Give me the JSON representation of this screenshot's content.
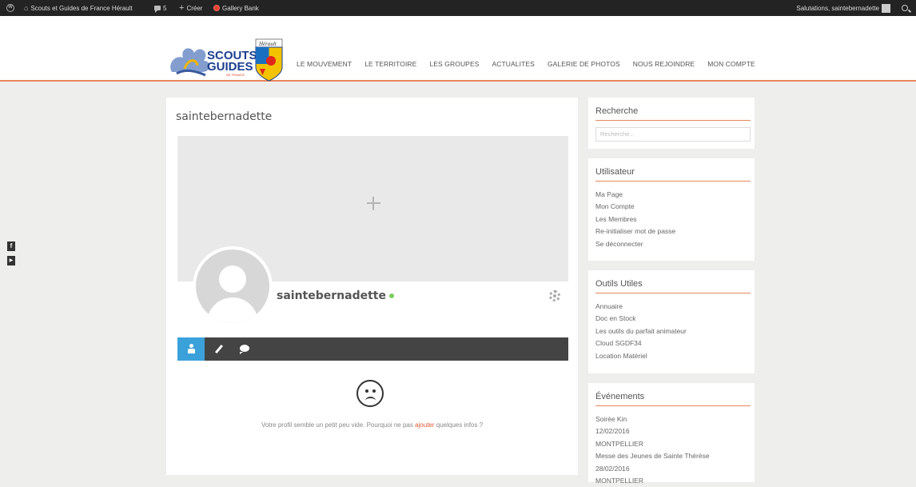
{
  "admin_bar": {
    "site_name": "Scouts et Guides de France Hérault",
    "comments_count": "5",
    "new_label": "Créer",
    "plugin_label": "Gallery Bank",
    "greeting": "Salutations, saintebernadette"
  },
  "header": {
    "logo_text_line1": "SCOUTS",
    "logo_text_line2": "GUIDES",
    "logo_text_line3": "DE FRANCE",
    "shield_text": "Hérault",
    "nav": [
      "LE MOUVEMENT",
      "LE TERRITOIRE",
      "LES GROUPES",
      "ACTUALITES",
      "GALERIE DE PHOTOS",
      "NOUS REJOINDRE",
      "MON COMPTE"
    ]
  },
  "social": {
    "facebook": "f",
    "youtube": "▶"
  },
  "profile": {
    "page_title": "saintebernadette",
    "name": "saintebernadette",
    "empty_message_before": "Votre profil semble un petit peu vide. Pourquoi ne pas ",
    "empty_message_link": "ajouter",
    "empty_message_after": " quelques infos ?"
  },
  "sidebar": {
    "search": {
      "title": "Recherche",
      "placeholder": "Recherche..."
    },
    "user": {
      "title": "Utilisateur",
      "items": [
        "Ma Page",
        "Mon Compte",
        "Les Membres",
        "Re-initialiser mot de passe",
        "Se déconnecter"
      ]
    },
    "tools": {
      "title": "Outils Utiles",
      "items": [
        "Annuaire",
        "Doc en Stock",
        "Les outils du parfait animateur",
        "Cloud SGDF34",
        "Location Matériel"
      ]
    },
    "events": {
      "title": "Événements",
      "items": [
        "Soirée Kin",
        "12/02/2016",
        "MONTPELLIER",
        "Messe des Jeunes de Sainte Thérèse",
        "28/02/2016",
        "MONTPELLIER"
      ]
    }
  },
  "colors": {
    "accent": "#e7875c",
    "tab_active": "#3ba1da",
    "online": "#7acf5b"
  }
}
